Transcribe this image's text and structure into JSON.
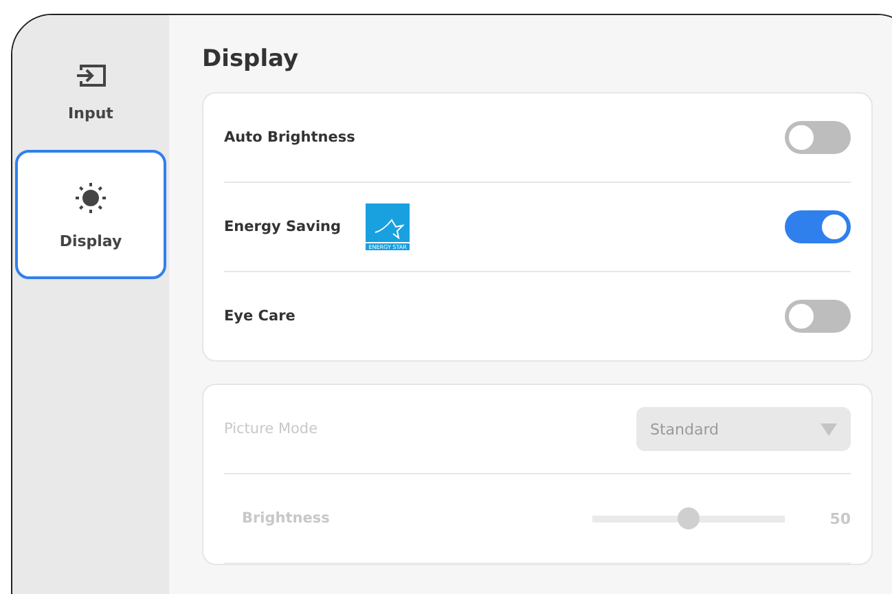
{
  "sidebar": {
    "items": [
      {
        "label": "Input",
        "selected": false
      },
      {
        "label": "Display",
        "selected": true
      }
    ]
  },
  "title": "Display",
  "sections": [
    {
      "disabled": false,
      "rows": [
        {
          "kind": "toggle",
          "label": "Auto Brightness",
          "on": false
        },
        {
          "kind": "toggle",
          "label": "Energy Saving",
          "on": true,
          "badge": "ENERGY STAR"
        },
        {
          "kind": "toggle",
          "label": "Eye Care",
          "on": false
        }
      ]
    },
    {
      "disabled": true,
      "rows": [
        {
          "kind": "dropdown",
          "label": "Picture Mode",
          "value": "Standard"
        },
        {
          "kind": "slider",
          "label": "Brightness",
          "level": 0.5,
          "reading": "50"
        }
      ]
    }
  ]
}
